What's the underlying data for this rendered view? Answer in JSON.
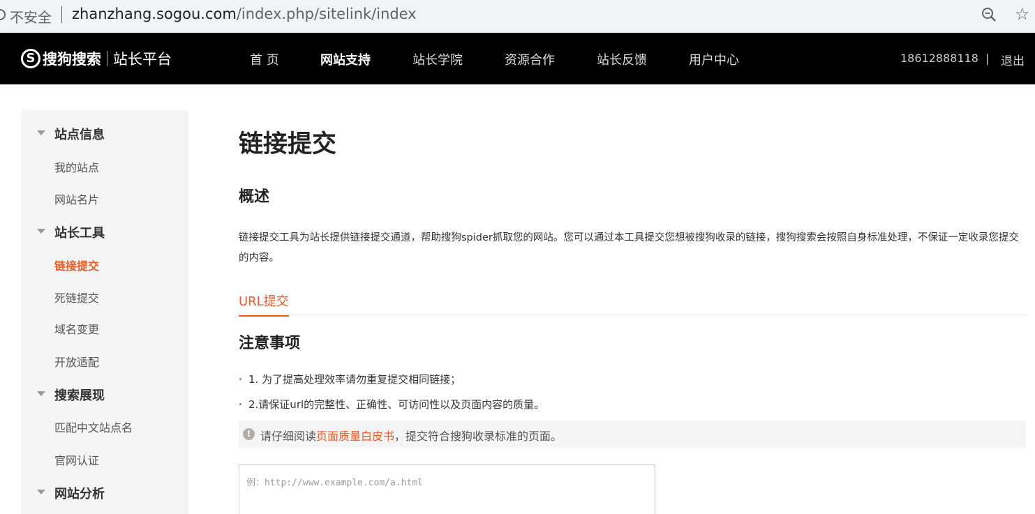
{
  "browser": {
    "security_label": "不安全",
    "url_host": "zhanzhang.sogou.com",
    "url_path": "/index.php/sitelink/index"
  },
  "header": {
    "logo_brand": "搜狗搜索",
    "logo_platform": "站长平台",
    "nav": [
      {
        "label": "首 页",
        "active": false
      },
      {
        "label": "网站支持",
        "active": true
      },
      {
        "label": "站长学院",
        "active": false
      },
      {
        "label": "资源合作",
        "active": false
      },
      {
        "label": "站长反馈",
        "active": false
      },
      {
        "label": "用户中心",
        "active": false
      }
    ],
    "phone": "18612888118",
    "separator": "|",
    "logout": "退出"
  },
  "sidebar": {
    "groups": [
      {
        "title": "站点信息",
        "items": [
          "我的站点",
          "网站名片"
        ]
      },
      {
        "title": "站长工具",
        "items": [
          "链接提交",
          "死链提交",
          "域名变更",
          "开放适配"
        ]
      },
      {
        "title": "搜索展现",
        "items": [
          "匹配中文站点名",
          "官网认证"
        ]
      },
      {
        "title": "网站分析",
        "items": []
      }
    ],
    "active_item": "链接提交"
  },
  "main": {
    "title": "链接提交",
    "overview_heading": "概述",
    "description": "链接提交工具为站长提供链接提交通道，帮助搜狗spider抓取您的网站。您可以通过本工具提交您想被搜狗收录的链接，搜狗搜索会按照自身标准处理，不保证一定收录您提交的内容。",
    "tab_label": "URL提交",
    "notes_heading": "注意事项",
    "notes": [
      "1. 为了提高处理效率请勿重复提交相同链接；",
      "2.请保证url的完整性、正确性、可访问性以及页面内容的质量。"
    ],
    "warning": {
      "before": "请仔细阅读",
      "link": "页面质量白皮书",
      "after": "，提交符合搜狗收录标准的页面。"
    },
    "url_input_placeholder": "例：http://www.example.com/a.html"
  },
  "colors": {
    "accent": "#f05a22",
    "nav_bg": "#000000",
    "sidebar_bg": "#f5f5f5"
  }
}
